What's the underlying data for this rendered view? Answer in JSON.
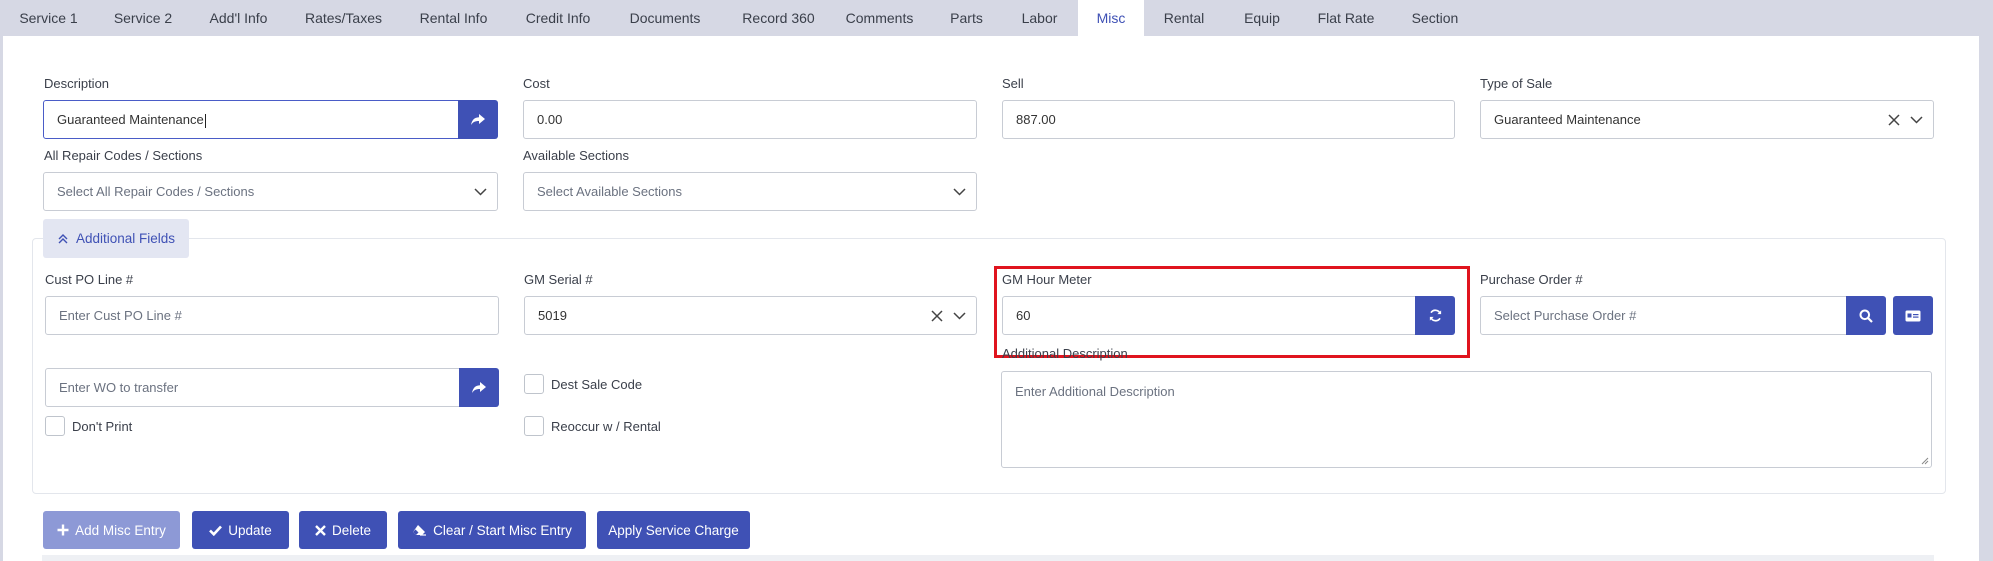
{
  "tabs": [
    {
      "label": "Service 1"
    },
    {
      "label": "Service 2"
    },
    {
      "label": "Add'l Info"
    },
    {
      "label": "Rates/Taxes"
    },
    {
      "label": "Rental Info"
    },
    {
      "label": "Credit Info"
    },
    {
      "label": "Documents"
    },
    {
      "label": "Record 360"
    },
    {
      "label": "Comments"
    },
    {
      "label": "Parts"
    },
    {
      "label": "Labor"
    },
    {
      "label": "Misc"
    },
    {
      "label": "Rental"
    },
    {
      "label": "Equip"
    },
    {
      "label": "Flat Rate"
    },
    {
      "label": "Section"
    }
  ],
  "active_tab": "Misc",
  "form": {
    "description": {
      "label": "Description",
      "value": "Guaranteed Maintenance"
    },
    "cost": {
      "label": "Cost",
      "value": "0.00"
    },
    "sell": {
      "label": "Sell",
      "value": "887.00"
    },
    "type_of_sale": {
      "label": "Type of Sale",
      "value": "Guaranteed Maintenance"
    },
    "repair_codes": {
      "label": "All Repair Codes / Sections",
      "placeholder": "Select All Repair Codes / Sections"
    },
    "available_sections": {
      "label": "Available Sections",
      "placeholder": "Select Available Sections"
    },
    "additional_fields_toggle": "Additional Fields",
    "cust_po_line": {
      "label": "Cust PO Line #",
      "placeholder": "Enter Cust PO Line #"
    },
    "gm_serial": {
      "label": "GM Serial #",
      "value": "5019"
    },
    "gm_hour_meter": {
      "label": "GM Hour Meter",
      "value": "60"
    },
    "purchase_order": {
      "label": "Purchase Order #",
      "placeholder": "Select Purchase Order #"
    },
    "wo_transfer": {
      "placeholder": "Enter WO to transfer"
    },
    "dest_sale_code": {
      "label": "Dest Sale Code",
      "checked": false
    },
    "reoccur_rental": {
      "label": "Reoccur w / Rental",
      "checked": false
    },
    "dont_print": {
      "label": "Don't Print",
      "checked": false
    },
    "additional_description": {
      "label": "Additional Description",
      "placeholder": "Enter Additional Description"
    }
  },
  "actions": {
    "add_misc_entry": "Add Misc Entry",
    "update": "Update",
    "delete": "Delete",
    "clear_start": "Clear / Start Misc Entry",
    "apply_service_charge": "Apply Service Charge"
  },
  "colors": {
    "primary": "#3f51b5",
    "primary_disabled": "#8d99d6",
    "tabbar_bg": "#d6d8e4",
    "highlight": "#e0141e"
  }
}
